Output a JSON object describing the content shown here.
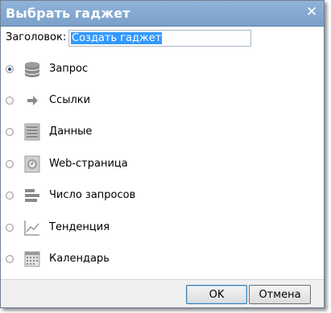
{
  "dialog": {
    "title": "Выбрать гаджет",
    "close_glyph": "✕"
  },
  "header": {
    "label": "Заголовок:",
    "value": "Создать гаджет"
  },
  "gadgets": [
    {
      "label": "Запрос",
      "icon": "database-icon",
      "selected": true
    },
    {
      "label": "Ссылки",
      "icon": "arrow-right-icon",
      "selected": false
    },
    {
      "label": "Данные",
      "icon": "document-icon",
      "selected": false
    },
    {
      "label": "Web-страница",
      "icon": "web-page-icon",
      "selected": false
    },
    {
      "label": "Число запросов",
      "icon": "bar-list-icon",
      "selected": false
    },
    {
      "label": "Тенденция",
      "icon": "trend-chart-icon",
      "selected": false
    },
    {
      "label": "Календарь",
      "icon": "calendar-icon",
      "selected": false
    }
  ],
  "buttons": {
    "ok": "OK",
    "cancel": "Отмена"
  }
}
